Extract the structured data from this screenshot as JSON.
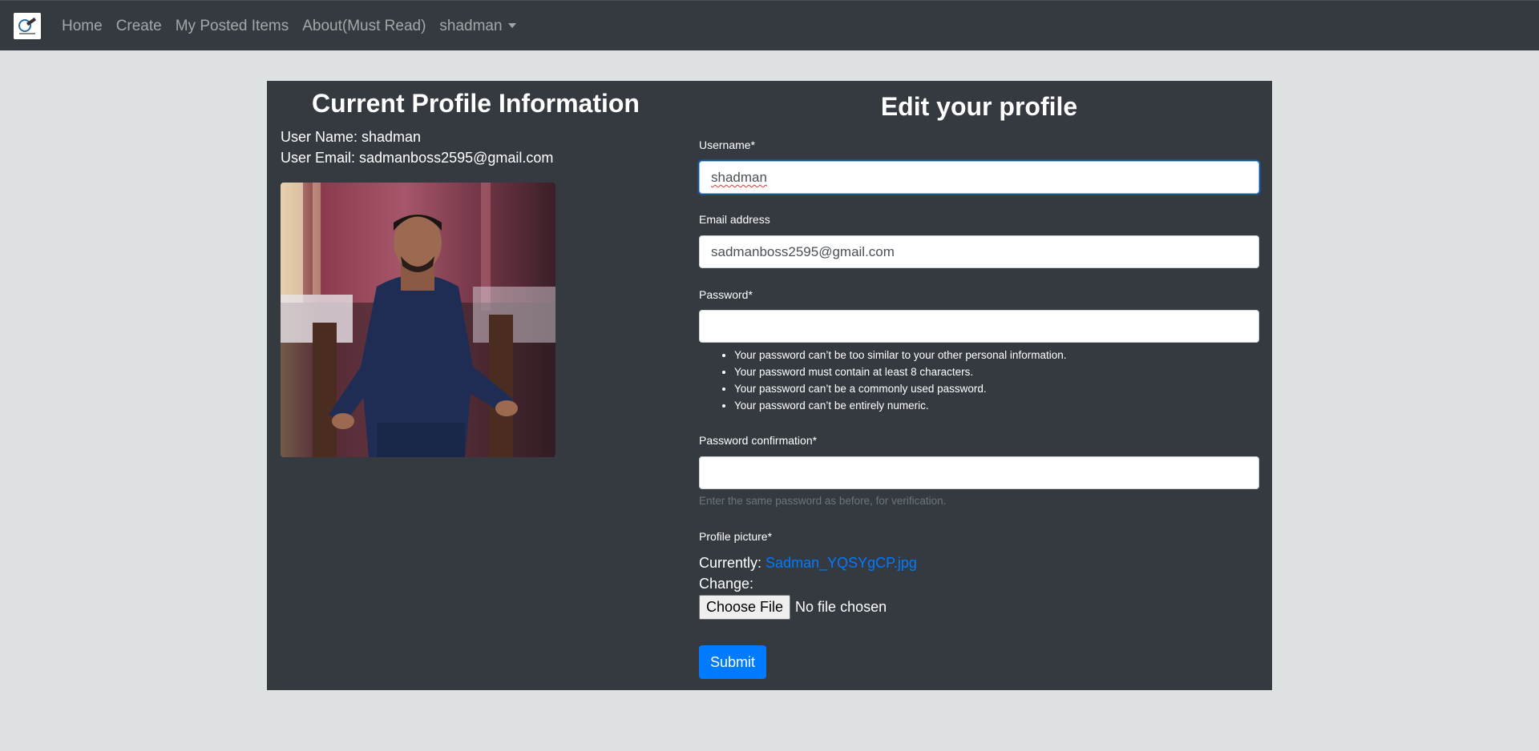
{
  "nav": {
    "brand_icon": "site-logo-icon",
    "links": [
      "Home",
      "Create",
      "My Posted Items",
      "About(Must Read)"
    ],
    "user": "shadman"
  },
  "profile": {
    "title": "Current Profile Information",
    "username_line": "User Name: shadman",
    "email_line": "User Email: sadmanboss2595@gmail.com",
    "photo_icon": "profile-photo"
  },
  "form": {
    "title": "Edit your profile",
    "username_label": "Username*",
    "username_value": "shadman",
    "email_label": "Email address",
    "email_value": "sadmanboss2595@gmail.com",
    "password_label": "Password*",
    "password_value": "",
    "password_help": [
      "Your password can’t be too similar to your other personal information.",
      "Your password must contain at least 8 characters.",
      "Your password can’t be a commonly used password.",
      "Your password can’t be entirely numeric."
    ],
    "confirm_label": "Password confirmation*",
    "confirm_value": "",
    "confirm_help": "Enter the same password as before, for verification.",
    "picture_label": "Profile picture*",
    "currently_label": "Currently:",
    "current_file": "Sadman_YQSYgCP.jpg",
    "change_label": "Change:",
    "choose_file_label": "Choose File",
    "no_file_text": "No file chosen",
    "submit_label": "Submit"
  },
  "colors": {
    "navbar": "#343a40",
    "page_bg": "#dee2e3",
    "panel_bg": "#353a41",
    "primary": "#007bff"
  }
}
